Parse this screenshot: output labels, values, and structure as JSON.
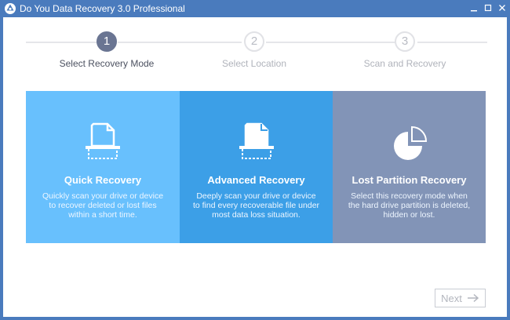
{
  "window": {
    "title": "Do You Data Recovery 3.0 Professional",
    "controls": [
      "minimize-icon",
      "restore-icon",
      "close-icon"
    ]
  },
  "steps": [
    {
      "number": "1",
      "label": "Select Recovery Mode",
      "active": true
    },
    {
      "number": "2",
      "label": "Select Location",
      "active": false
    },
    {
      "number": "3",
      "label": "Scan and Recovery",
      "active": false
    }
  ],
  "cards": [
    {
      "title": "Quick Recovery",
      "description": "Quickly scan your drive or device to recover deleted or lost files within a short time.",
      "icon": "document-scan-icon",
      "color": "#68c0fd"
    },
    {
      "title": "Advanced Recovery",
      "description": "Deeply scan your drive or device to find every recoverable file under most data loss situation.",
      "icon": "document-scan-icon",
      "color": "#3c9fe7"
    },
    {
      "title": "Lost Partition Recovery",
      "description": "Select this recovery mode when the hard drive partition is deleted, hidden or lost.",
      "icon": "pie-chart-icon",
      "color": "#8294b7"
    }
  ],
  "footer": {
    "next_label": "Next",
    "next_icon": "arrow-right-icon"
  },
  "colors": {
    "titlebar": "#4a7bbd",
    "active_step": "#6a7592"
  }
}
